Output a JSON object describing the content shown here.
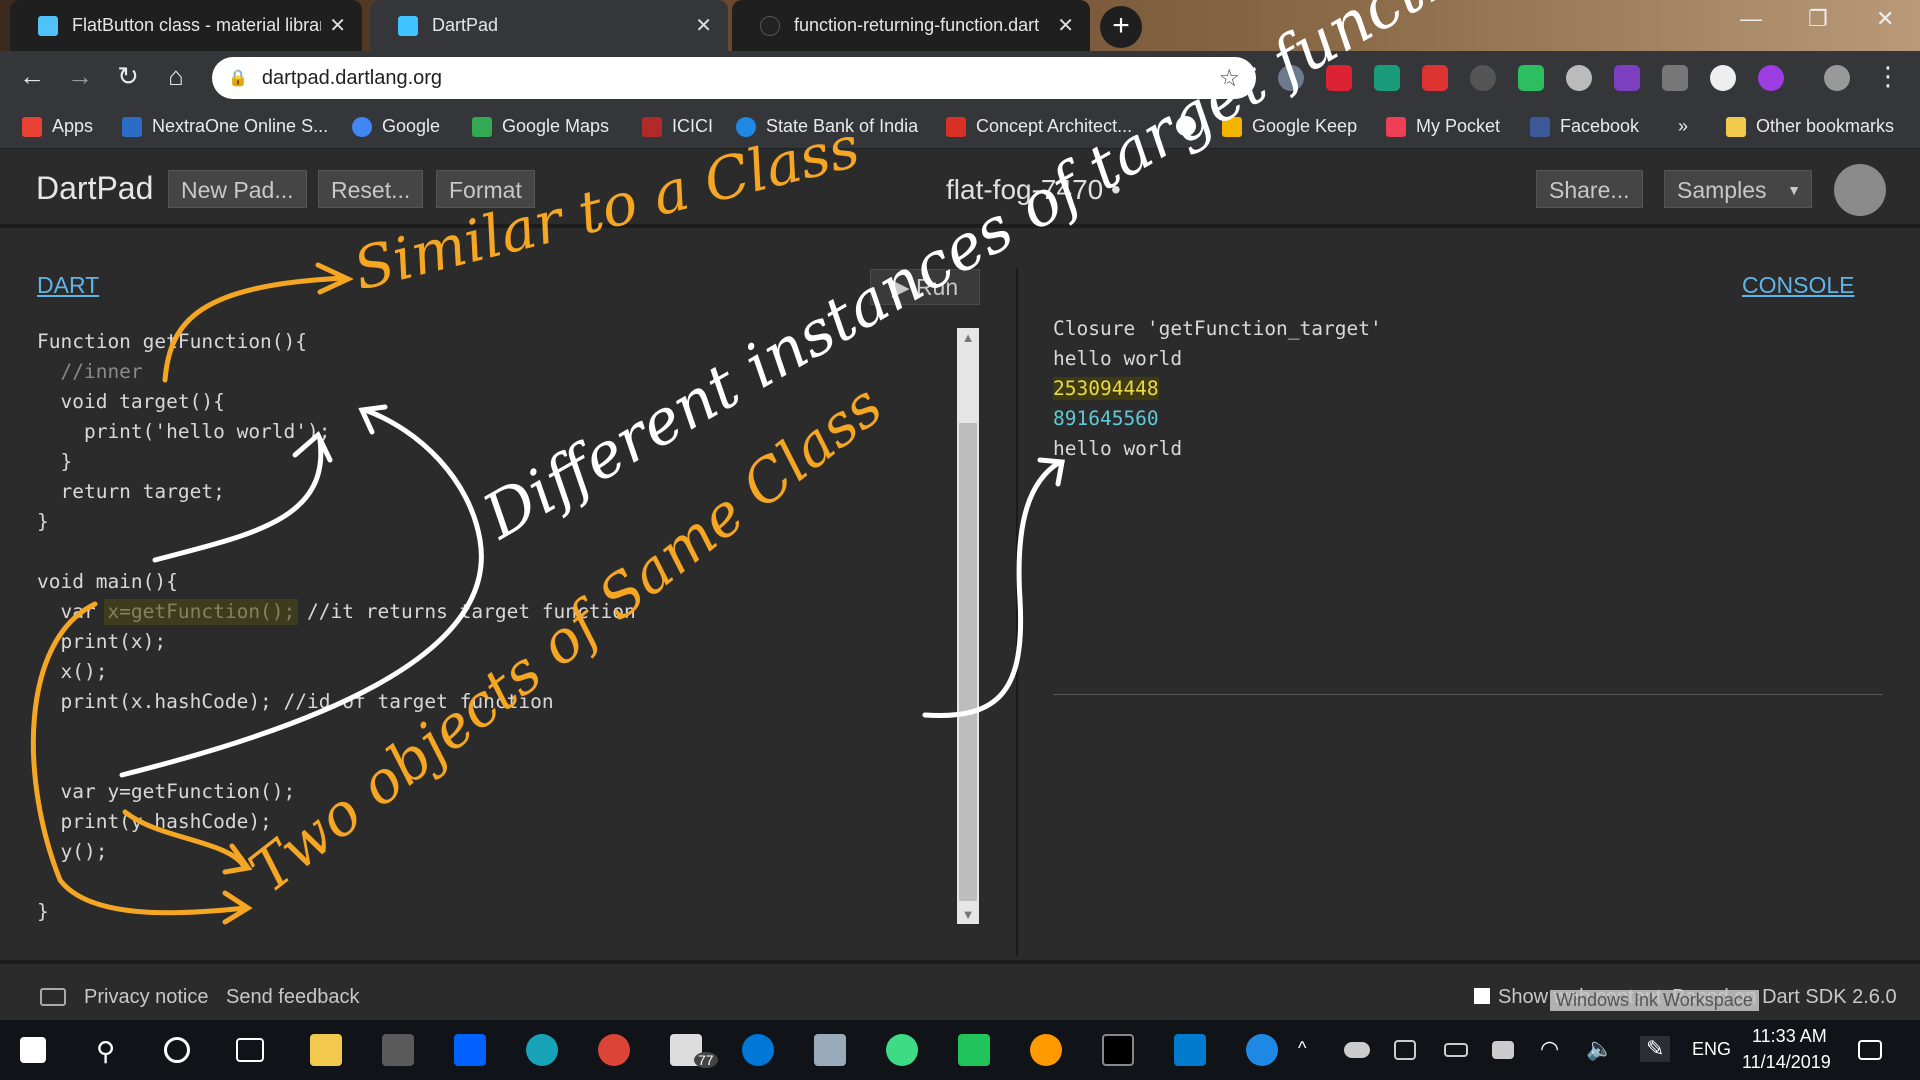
{
  "browser": {
    "tabs": [
      {
        "title": "FlatButton class - material library",
        "active": false
      },
      {
        "title": "DartPad",
        "active": true
      },
      {
        "title": "function-returning-function.dart",
        "active": false
      }
    ],
    "url": "dartpad.dartlang.org"
  },
  "bookmarks": [
    {
      "label": "Apps",
      "color": "#e94235"
    },
    {
      "label": "NextraOne Online S...",
      "color": "#2a6cc6"
    },
    {
      "label": "Google",
      "color": "#4285f4"
    },
    {
      "label": "Google Maps",
      "color": "#34a853"
    },
    {
      "label": "ICICI",
      "color": "#b02a2a"
    },
    {
      "label": "State Bank of India",
      "color": "#1e88e5"
    },
    {
      "label": "Concept Architect...",
      "color": "#d93025"
    },
    {
      "label": "Google Keep",
      "color": "#f4b400"
    },
    {
      "label": "My Pocket",
      "color": "#ef3f56"
    },
    {
      "label": "Facebook",
      "color": "#3b5998"
    },
    {
      "label": "»",
      "color": ""
    },
    {
      "label": "Other bookmarks",
      "color": "#f2c94c"
    }
  ],
  "dartpad": {
    "logo": "DartPad",
    "buttons": {
      "new_pad": "New Pad...",
      "reset": "Reset...",
      "format": "Format",
      "share": "Share...",
      "samples": "Samples"
    },
    "pad_title": "flat-fog-7470 •",
    "dart_tab": "DART",
    "run": "Run",
    "console_tab": "CONSOLE",
    "code_lines": [
      "Function getFunction(){",
      "  //inner",
      "  void target(){",
      "    print('hello world');",
      "  }",
      "  return target;",
      "}",
      "",
      "void main(){",
      "  var x=getFunction(); //it returns target function",
      "  print(x);",
      "  x();",
      "  print(x.hashCode); //id of target function",
      "",
      "",
      "  var y=getFunction();",
      "  print(y.hashCode);",
      "  y();",
      "",
      "}"
    ],
    "console_lines": [
      "Closure 'getFunction_target'",
      "hello world",
      "253094448",
      "891645560",
      "hello world"
    ]
  },
  "footer": {
    "privacy": "Privacy notice",
    "feedback": "Send feedback",
    "show_web": "Show web content",
    "sdk": "Based on Dart SDK 2.6.0",
    "ink_workspace": "Windows Ink Workspace"
  },
  "taskbar": {
    "mail_badge": "77",
    "language": "ENG",
    "time": "11:33 AM",
    "date": "11/14/2019"
  },
  "annotations": {
    "similar": "Similar to a Class",
    "different": "Different instances of target function",
    "two_objects": "Two objects of Same Class"
  }
}
